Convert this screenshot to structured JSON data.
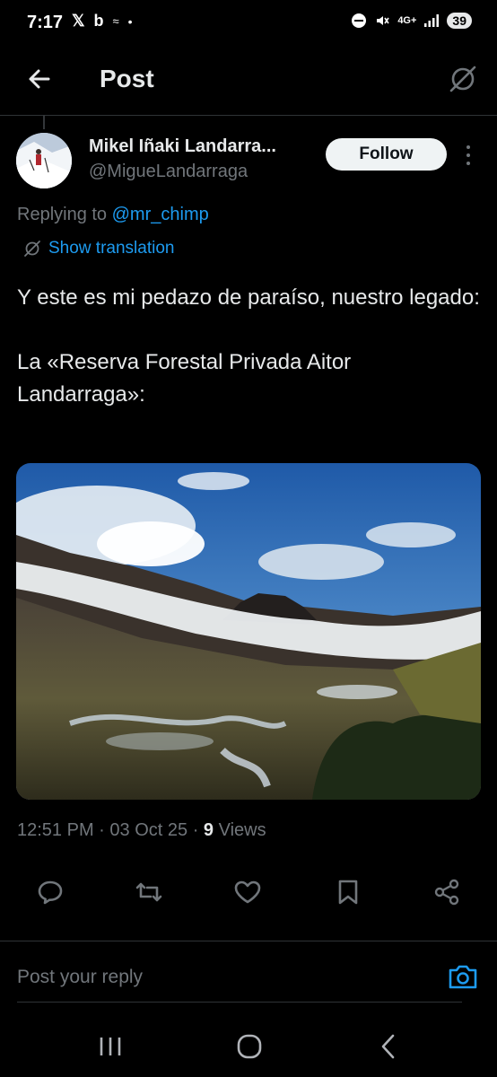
{
  "status_bar": {
    "time": "7:17",
    "left_icons": [
      "x-logo-icon",
      "b-app-icon",
      "signal-waves-icon",
      "dot-icon"
    ],
    "network": "4G+",
    "battery": "39"
  },
  "header": {
    "title": "Post",
    "back_icon": "arrow-left-icon",
    "grok_icon": "grok-icon"
  },
  "post": {
    "author_name": "Mikel Iñaki Landarra...",
    "author_handle": "@MigueLandarraga",
    "follow_label": "Follow",
    "replying_prefix": "Replying to",
    "replying_to": "@mr_chimp",
    "show_translation": "Show translation",
    "text": "Y este es mi pedazo de paraíso, nuestro legado:\n\nLa «Reserva Forestal Privada Aitor Landarraga»:",
    "time": "12:51 PM",
    "date": "03 Oct 25",
    "views_count": "9",
    "views_label": "Views",
    "sep": "·"
  },
  "actions": [
    "reply-icon",
    "repost-icon",
    "like-icon",
    "bookmark-icon",
    "share-icon"
  ],
  "reply": {
    "placeholder": "Post your reply"
  },
  "colors": {
    "background": "#000000",
    "accent": "#1d9bf0",
    "secondary_text": "#71767b",
    "divider": "#2f3336"
  }
}
